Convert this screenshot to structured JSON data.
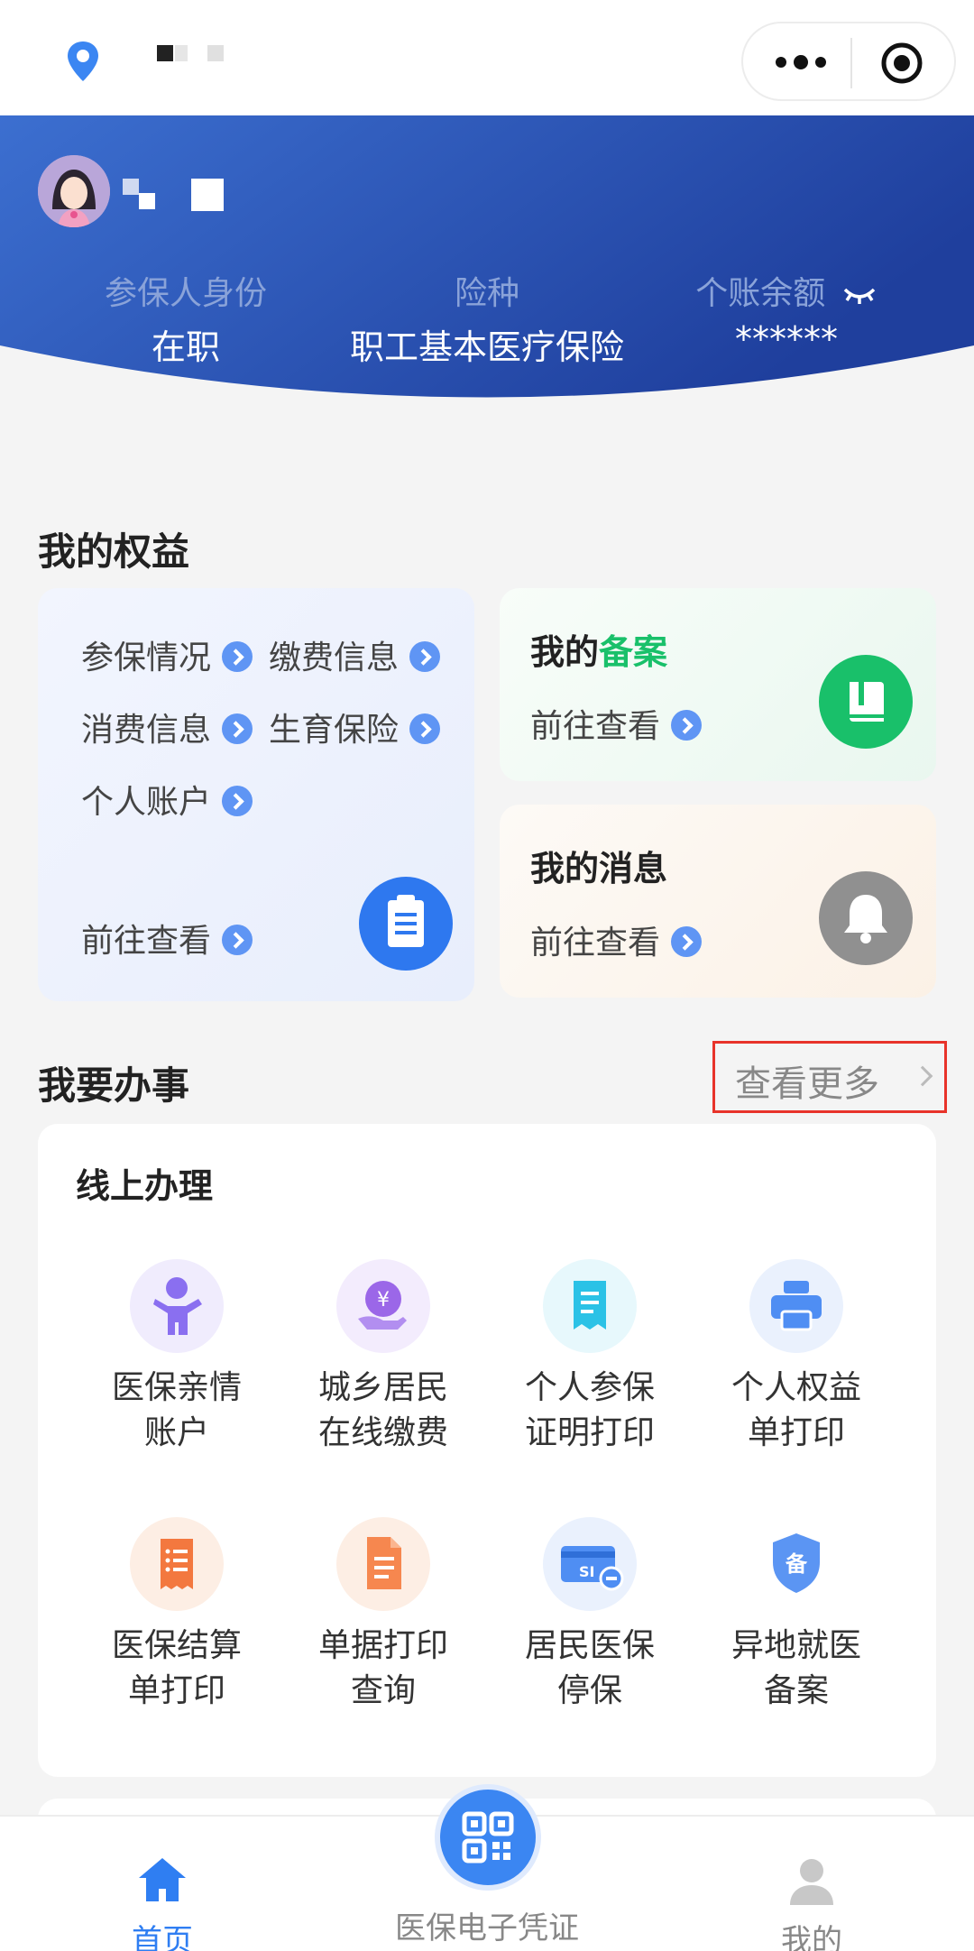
{
  "header": {
    "capsule_more": "more-dots-icon",
    "capsule_close": "target-circle-icon"
  },
  "banner": {
    "identity_label": "参保人身份",
    "identity_value": "在职",
    "insurance_label": "险种",
    "insurance_value": "职工基本医疗保险",
    "balance_label": "个账余额",
    "balance_value": "******"
  },
  "benefits": {
    "title": "我的权益",
    "items": [
      "参保情况",
      "缴费信息",
      "消费信息",
      "生育保险",
      "个人账户"
    ],
    "goto": "前往查看"
  },
  "record": {
    "title_a": "我的",
    "title_b": "备案",
    "goto": "前往查看"
  },
  "message": {
    "title": "我的消息",
    "goto": "前往查看"
  },
  "tasks": {
    "title": "我要办事",
    "more": "查看更多"
  },
  "online": {
    "title": "线上办理",
    "tiles": [
      {
        "l1": "医保亲情",
        "l2": "账户"
      },
      {
        "l1": "城乡居民",
        "l2": "在线缴费"
      },
      {
        "l1": "个人参保",
        "l2": "证明打印"
      },
      {
        "l1": "个人权益",
        "l2": "单打印"
      },
      {
        "l1": "医保结算",
        "l2": "单打印"
      },
      {
        "l1": "单据打印",
        "l2": "查询"
      },
      {
        "l1": "居民医保",
        "l2": "停保"
      },
      {
        "l1": "异地就医",
        "l2": "备案"
      }
    ]
  },
  "tabbar": {
    "home": "首页",
    "voucher": "医保电子凭证",
    "mine": "我的"
  },
  "colors": {
    "accent": "#3b86f2",
    "banner_start": "#3c6fd0",
    "banner_end": "#1f3f9d",
    "green": "#19c06a"
  }
}
